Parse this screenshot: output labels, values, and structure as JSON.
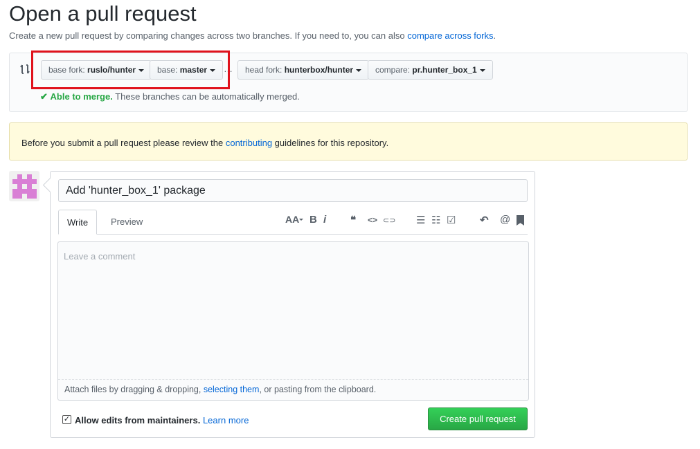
{
  "page": {
    "title": "Open a pull request",
    "subtitle": "Create a new pull request by comparing changes across two branches. If you need to, you can also ",
    "subtitle_link": "compare across forks",
    "subtitle_end": "."
  },
  "range": {
    "base_fork": {
      "label": "base fork:",
      "value": "ruslo/hunter"
    },
    "base": {
      "label": "base:",
      "value": "master"
    },
    "separator": "…",
    "head_fork": {
      "label": "head fork:",
      "value": "hunterbox/hunter"
    },
    "compare": {
      "label": "compare:",
      "value": "pr.hunter_box_1"
    },
    "merge_status": "Able to merge.",
    "merge_text": "These branches can be automatically merged."
  },
  "flash": {
    "before": "Before you submit a pull request please review the ",
    "link": "contributing",
    "after": " guidelines for this repository."
  },
  "form": {
    "title_value": "Add 'hunter_box_1' package",
    "tabs": [
      "Write",
      "Preview"
    ],
    "placeholder": "Leave a comment",
    "attach_before": "Attach files by dragging & dropping, ",
    "attach_link": "selecting them",
    "attach_after": ", or pasting from the clipboard.",
    "allow_edits": "Allow edits from maintainers.",
    "learn_more": "Learn more",
    "submit": "Create pull request",
    "toolbar": {
      "header": "AA",
      "bold": "B",
      "italic": "i",
      "quote": "❝",
      "code": "<>",
      "link": "⊂⊃",
      "ul": "☰",
      "ol": "☷",
      "task": "☑",
      "reply": "↶",
      "mention": "@",
      "saved": "🔖"
    }
  },
  "colors": {
    "accent": "#0366d6",
    "success": "#28a745",
    "highlight": "#e0121c",
    "identicon": "#d97fd5"
  }
}
